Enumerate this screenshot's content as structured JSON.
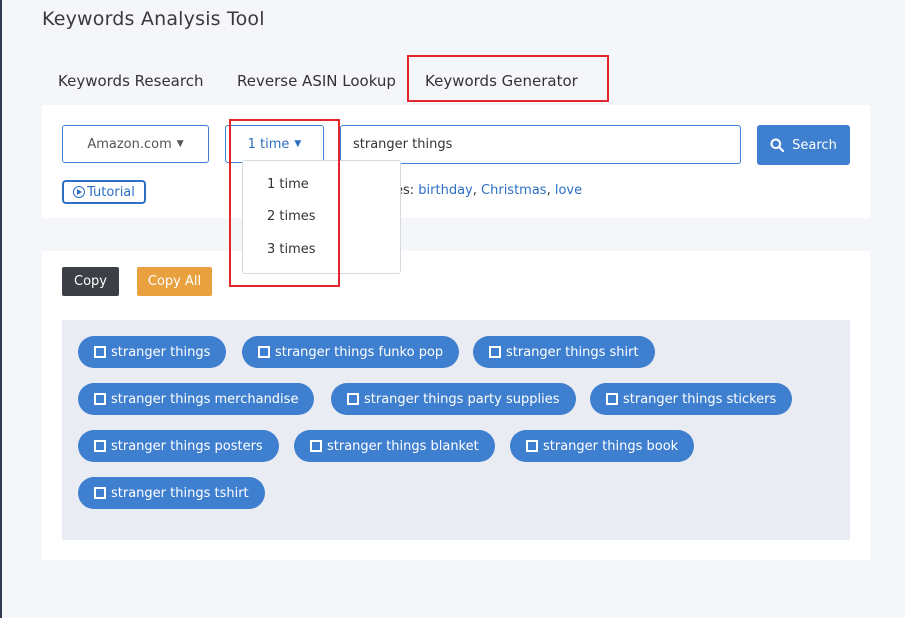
{
  "page_title": "Keywords Analysis Tool",
  "tabs": [
    "Keywords Research",
    "Reverse ASIN Lookup",
    "Keywords Generator"
  ],
  "active_tab": "Keywords Generator",
  "market_select": {
    "value": "Amazon.com"
  },
  "times_select": {
    "value": "1 time",
    "options": [
      "1 time",
      "2 times",
      "3 times"
    ]
  },
  "search": {
    "value": "stranger things",
    "button_label": "Search"
  },
  "tutorial_label": "Tutorial",
  "examples": {
    "prefix": "es:",
    "links": [
      "birthday",
      "Christmas",
      "love"
    ]
  },
  "actions": {
    "copy_label": "Copy",
    "copy_all_label": "Copy All"
  },
  "keywords": [
    "stranger things",
    "stranger things funko pop",
    "stranger things shirt",
    "stranger things merchandise",
    "stranger things party supplies",
    "stranger things stickers",
    "stranger things posters",
    "stranger things blanket",
    "stranger things book",
    "stranger things tshirt"
  ],
  "colors": {
    "accent": "#3f7fcf",
    "highlight": "#e3262b",
    "copy_button": "#3c4046",
    "copy_all_button": "#e8a13e"
  }
}
